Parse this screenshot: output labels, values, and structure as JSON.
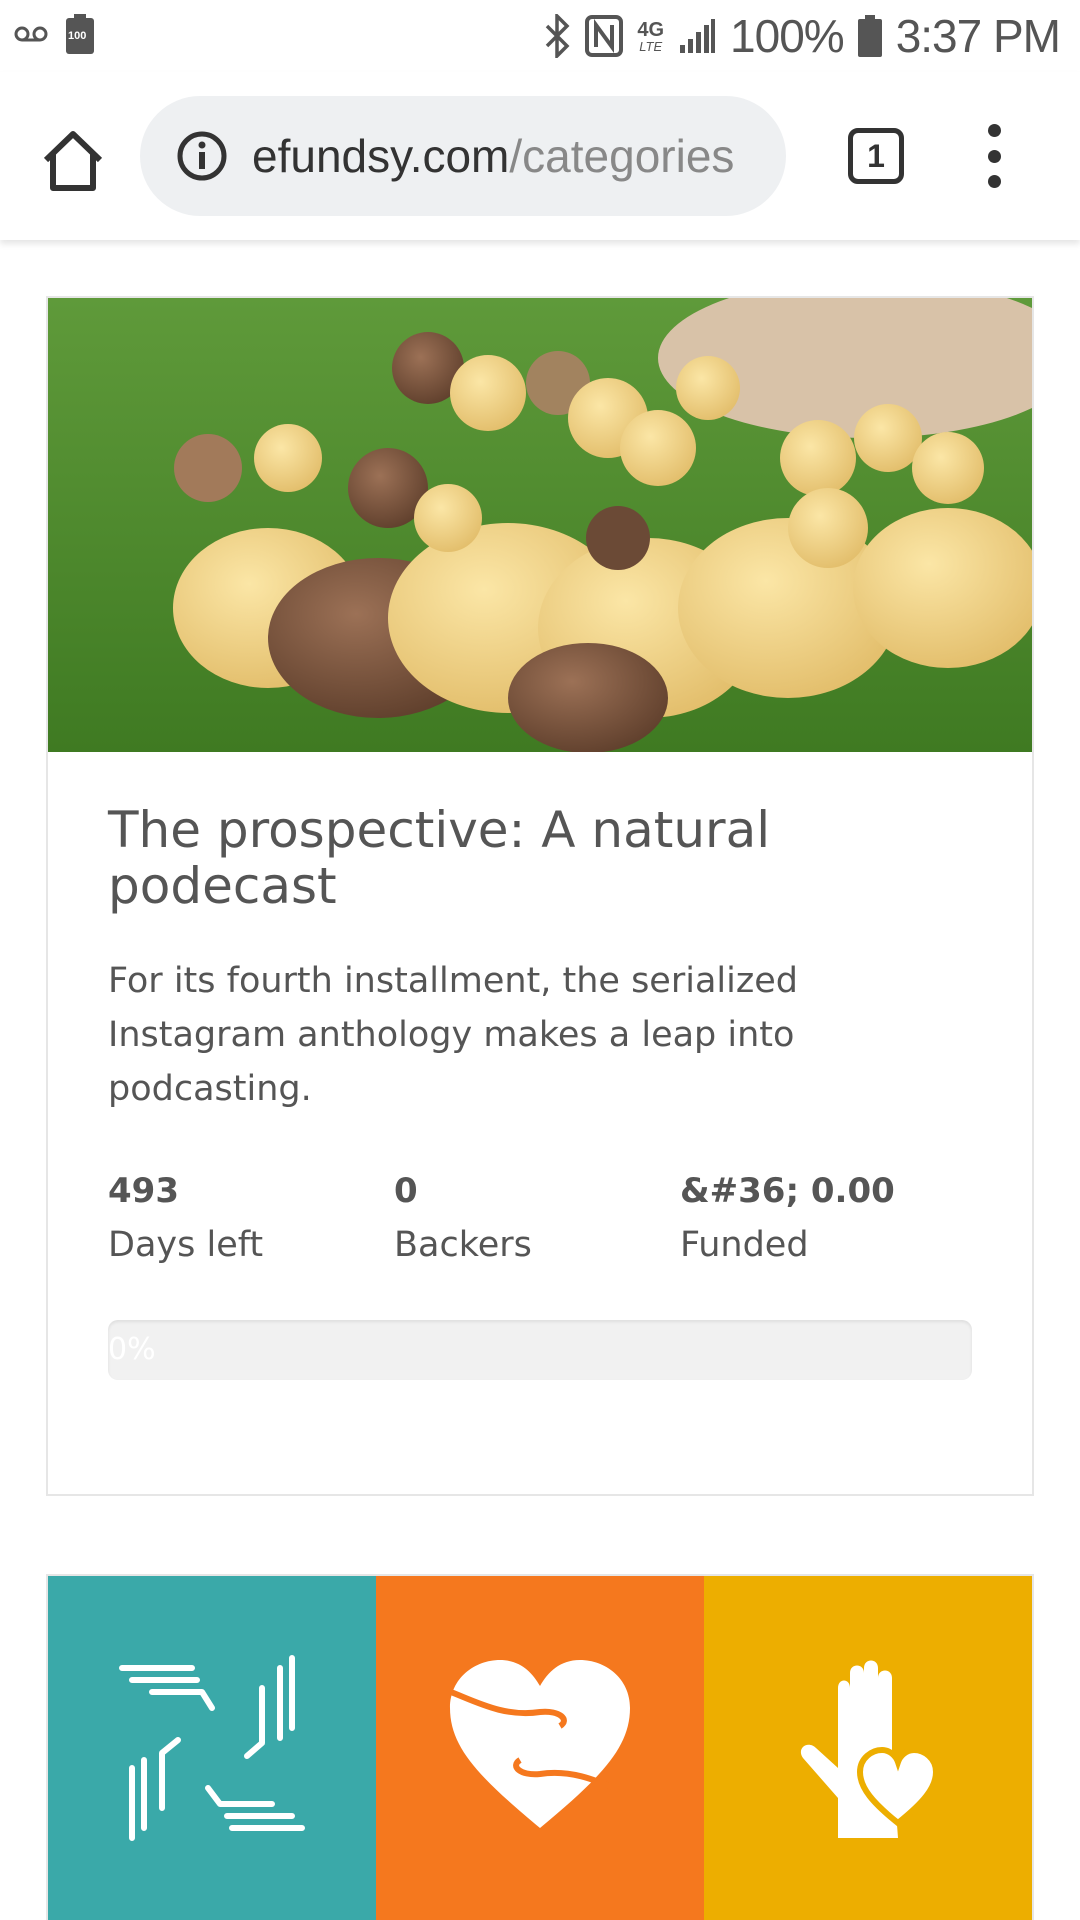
{
  "status_bar": {
    "battery_small": "100",
    "battery_percent": "100%",
    "time": "3:37 PM",
    "network_label": "4G",
    "network_sub": "LTE"
  },
  "toolbar": {
    "url_host": "efundsy.com",
    "url_path": "/categories",
    "tab_count": "1"
  },
  "card": {
    "image_alt": "Ducklings on grass",
    "title": "The prospective: A natural podecast",
    "description": "For its fourth installment, the serialized Instagram anthology makes a leap into podcasting.",
    "stats": [
      {
        "value": "493",
        "label": "Days left"
      },
      {
        "value": "0",
        "label": "Backers"
      },
      {
        "value": "&#36; 0.00",
        "label": "Funded"
      }
    ],
    "progress": {
      "percent": 0,
      "label": "0%"
    }
  },
  "tiles": [
    {
      "icon": "hands-circle-icon",
      "color": "#3aa9a9"
    },
    {
      "icon": "heart-hands-icon",
      "color": "#f5781e"
    },
    {
      "icon": "hand-heart-icon",
      "color": "#edae00"
    }
  ],
  "colors": {
    "teal": "#3aa9a9",
    "orange": "#f5781e",
    "yellow": "#edae00",
    "text": "#555555"
  }
}
